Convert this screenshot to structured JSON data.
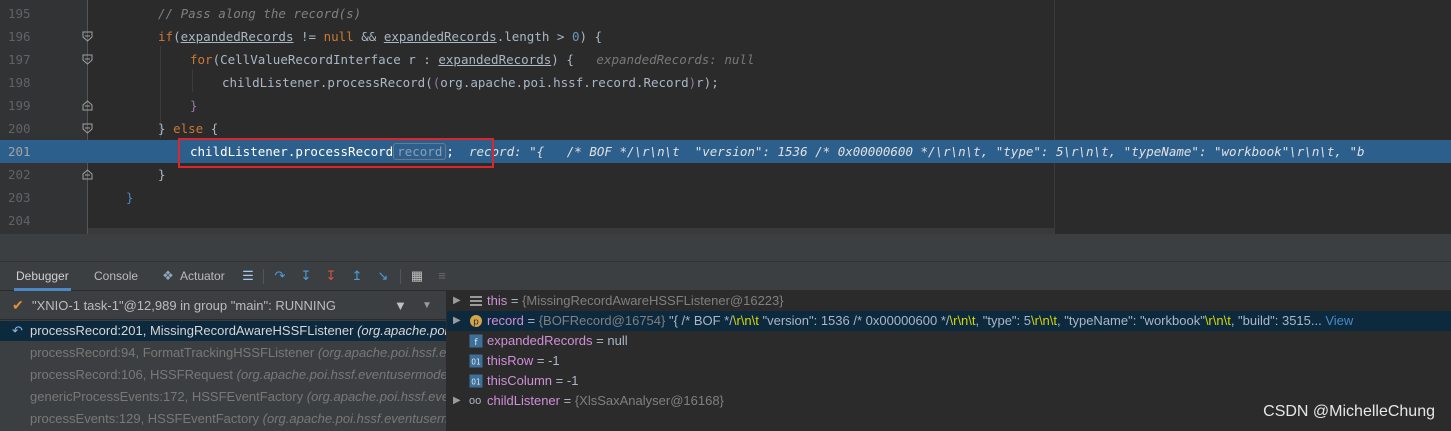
{
  "editor": {
    "lines": [
      {
        "num": "195"
      },
      {
        "num": "196"
      },
      {
        "num": "197"
      },
      {
        "num": "198"
      },
      {
        "num": "199"
      },
      {
        "num": "200"
      },
      {
        "num": "201"
      },
      {
        "num": "202"
      },
      {
        "num": "203"
      },
      {
        "num": "204"
      }
    ],
    "comment": "// Pass along the record(s)",
    "l196": {
      "kw_if": "if",
      "open": "(",
      "var": "expandedRecords",
      "op": " != ",
      "null": "null",
      "and": " && ",
      "var2": "expandedRecords",
      "rest": ".length > ",
      "zero": "0",
      "close": ") {"
    },
    "l197": {
      "kw_for": "for",
      "open": "(",
      "type": "CellValueRecordInterface",
      "mid": " r : ",
      "var": "expandedRecords",
      "close": ") {",
      "inlay": "expandedRecords: null"
    },
    "l198": {
      "call": "childListener.processRecord(",
      "cast_open": "(",
      "cast": "org.apache.poi.hssf.record.Record",
      "cast_close": ")",
      "rest": "r);"
    },
    "l199": {
      "brace": "}"
    },
    "l200": {
      "text": "} ",
      "kw_else": "else",
      "rest": " {"
    },
    "l201": {
      "call": "childListener.processRecord",
      "hint": "record",
      "rest": ";",
      "inlay": "record: \"{   /* BOF */\\r\\n\\t  \"version\": 1536 /* 0x00000600 */\\r\\n\\t, \"type\": 5\\r\\n\\t, \"typeName\": \"workbook\"\\r\\n\\t, \"b"
    },
    "l202": {
      "brace": "}"
    },
    "l203": {
      "brace": "}"
    }
  },
  "toolbar": {
    "tabs": [
      "Debugger",
      "Console",
      "Actuator"
    ]
  },
  "frames": {
    "thread": "\"XNIO-1 task-1\"@12,989 in group \"main\": RUNNING",
    "items": [
      {
        "method": "processRecord:201, MissingRecordAwareHSSFListener",
        "pkg": "(org.apache.poi.hssf.eventusermodel)"
      },
      {
        "method": "processRecord:94, FormatTrackingHSSFListener",
        "pkg": "(org.apache.poi.hssf.eventusermodel)"
      },
      {
        "method": "processRecord:106, HSSFRequest",
        "pkg": "(org.apache.poi.hssf.eventusermodel)"
      },
      {
        "method": "genericProcessEvents:172, HSSFEventFactory",
        "pkg": "(org.apache.poi.hssf.eventusermodel)"
      },
      {
        "method": "processEvents:129, HSSFEventFactory",
        "pkg": "(org.apache.poi.hssf.eventusermodel)"
      }
    ]
  },
  "variables": {
    "this": {
      "name": "this",
      "eq": " = ",
      "val": "{MissingRecordAwareHSSFListener@16223}"
    },
    "record": {
      "name": "record",
      "eq": " = ",
      "ref": "{BOFRecord@16754}",
      "s1": " \"{   /* BOF */",
      "e1": "\\r\\n\\t",
      "s2": "  \"version\": 1536 /* 0x00000600 */",
      "e2": "\\r\\n\\t",
      "s3": ", \"type\": 5",
      "e3": "\\r\\n\\t",
      "s4": ", \"typeName\": \"workbook\"",
      "e4": "\\r\\n\\t",
      "s5": ", \"build\": 3515...",
      "view": " View"
    },
    "expandedRecords": {
      "name": "expandedRecords",
      "eq": " = ",
      "val": "null"
    },
    "thisRow": {
      "name": "thisRow",
      "eq": " = ",
      "val": "-1"
    },
    "thisColumn": {
      "name": "thisColumn",
      "eq": " = ",
      "val": "-1"
    },
    "childListener": {
      "name": "childListener",
      "eq": " = ",
      "val": "{XlsSaxAnalyser@16168}"
    }
  },
  "watermark": "CSDN @MichelleChung"
}
